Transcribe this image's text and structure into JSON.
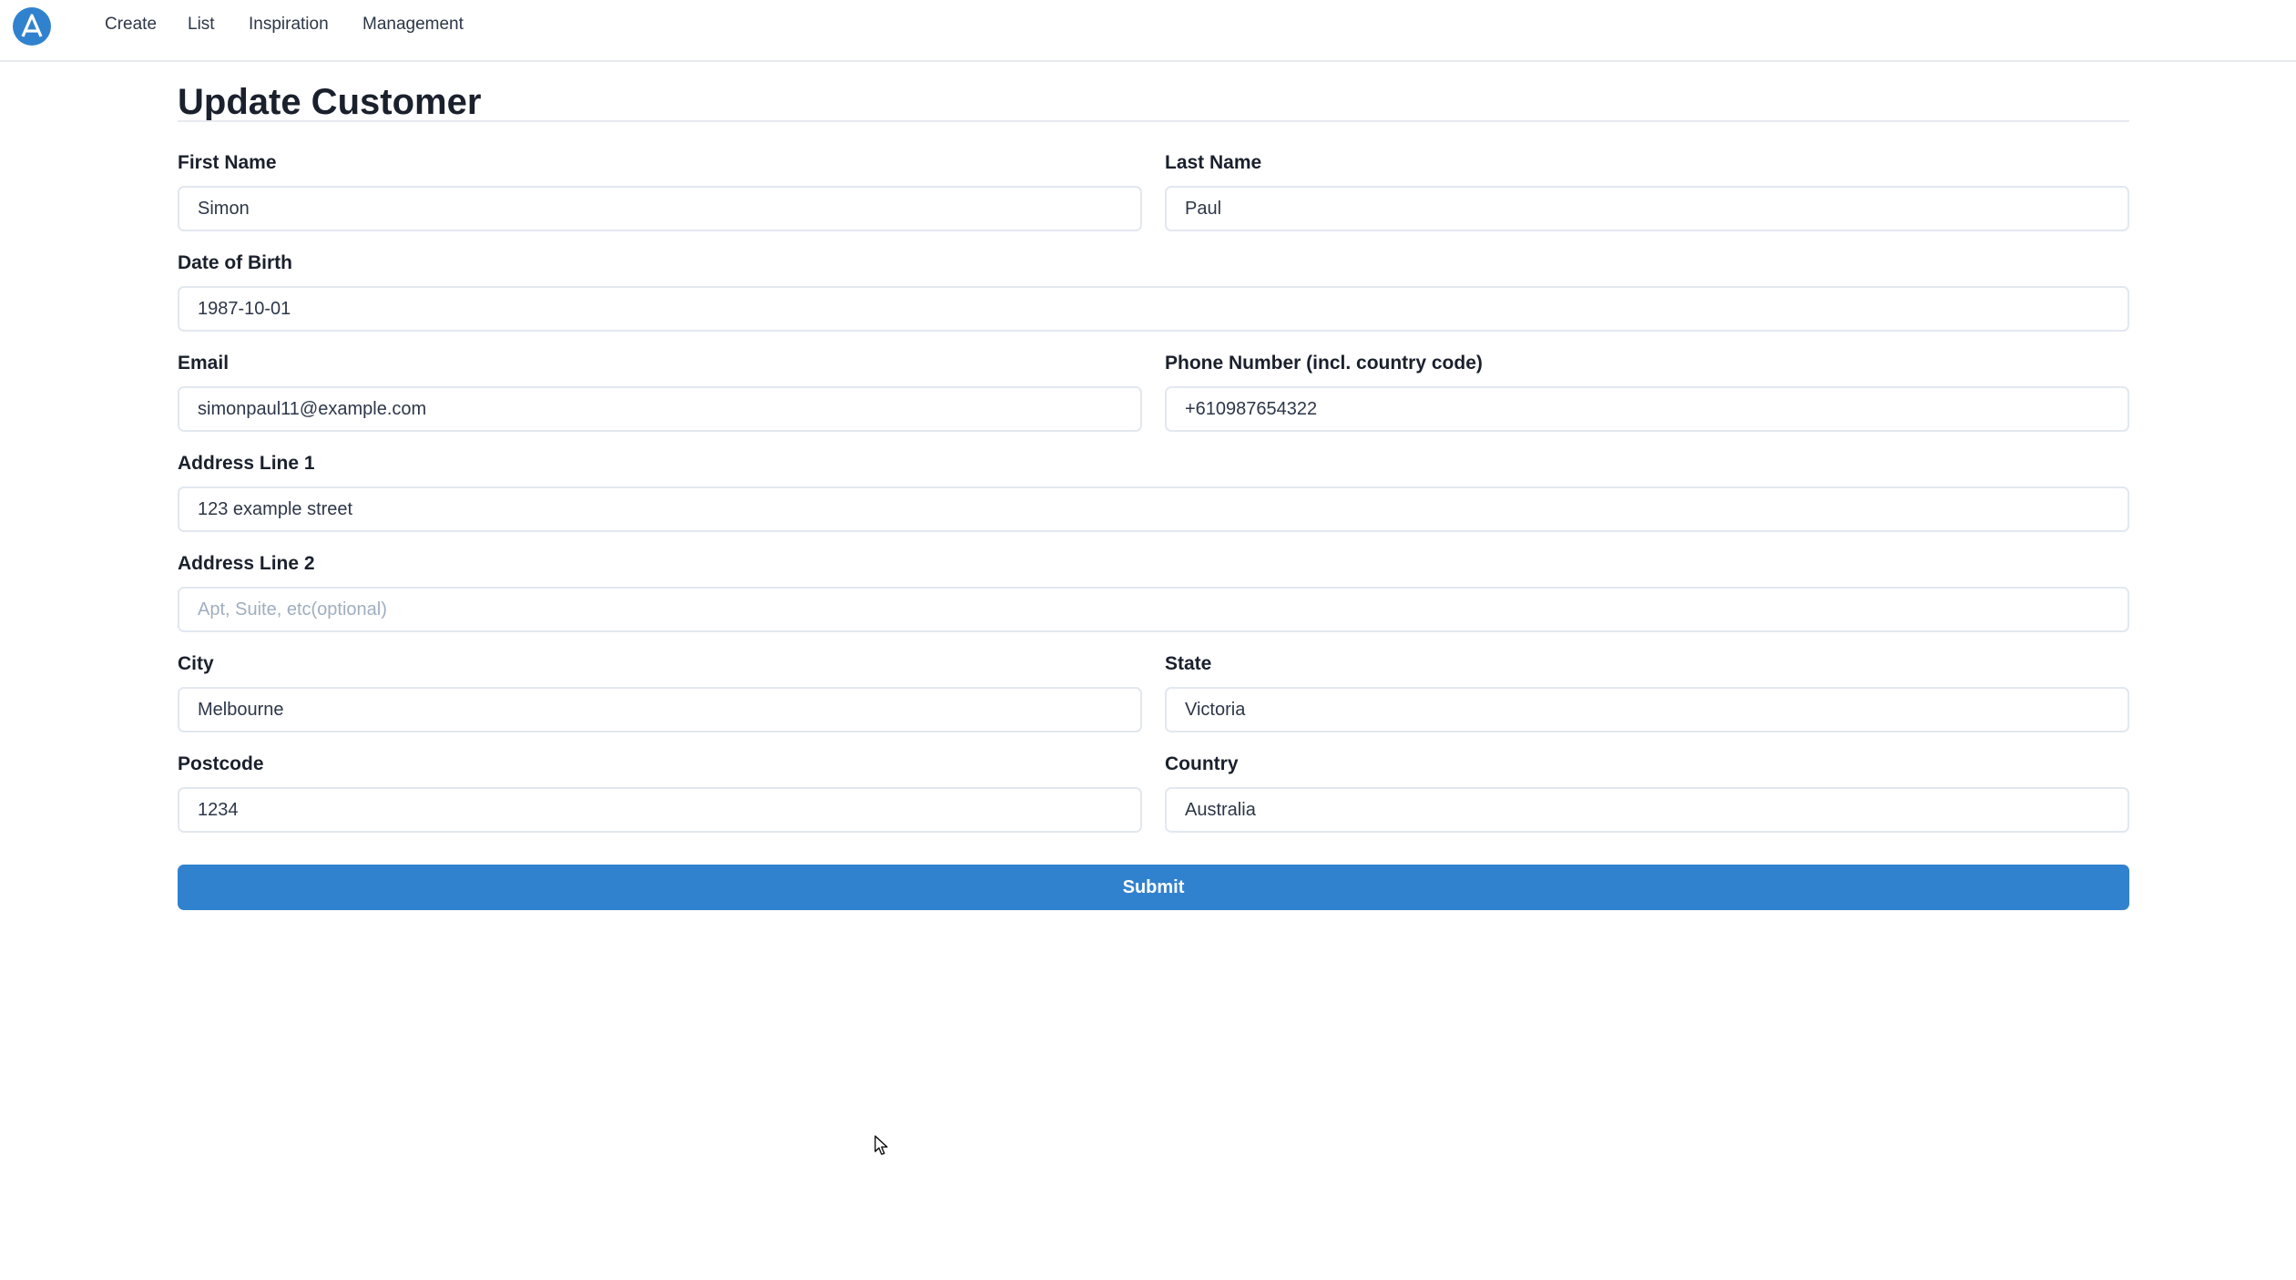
{
  "navbar": {
    "logo_icon": "letter-a-circle-logo",
    "items": [
      {
        "label": "Create"
      },
      {
        "label": "List"
      },
      {
        "label": "Inspiration"
      },
      {
        "label": "Management"
      }
    ]
  },
  "page": {
    "title": "Update Customer"
  },
  "form": {
    "first_name": {
      "label": "First Name",
      "value": "Simon",
      "placeholder": ""
    },
    "last_name": {
      "label": "Last Name",
      "value": "Paul",
      "placeholder": ""
    },
    "date_of_birth": {
      "label": "Date of Birth",
      "value": "1987-10-01",
      "placeholder": ""
    },
    "email": {
      "label": "Email",
      "value": "simonpaul11@example.com",
      "placeholder": ""
    },
    "phone": {
      "label": "Phone Number (incl. country code)",
      "value": "+610987654322",
      "placeholder": ""
    },
    "address_line_1": {
      "label": "Address Line 1",
      "value": "123 example street",
      "placeholder": ""
    },
    "address_line_2": {
      "label": "Address Line 2",
      "value": "",
      "placeholder": "Apt, Suite, etc(optional)"
    },
    "city": {
      "label": "City",
      "value": "Melbourne",
      "placeholder": ""
    },
    "state": {
      "label": "State",
      "value": "Victoria",
      "placeholder": ""
    },
    "postcode": {
      "label": "Postcode",
      "value": "1234",
      "placeholder": ""
    },
    "country": {
      "label": "Country",
      "value": "Australia",
      "placeholder": ""
    },
    "submit_label": "Submit"
  },
  "colors": {
    "accent": "#3182ce",
    "border": "#e2e8f0",
    "text": "#1a202c",
    "placeholder": "#a0aec0"
  }
}
